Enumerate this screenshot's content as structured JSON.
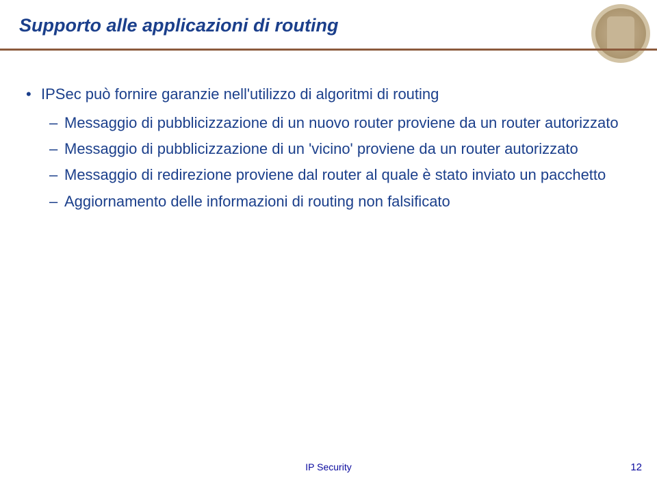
{
  "title": "Supporto alle applicazioni di routing",
  "main_bullet": "IPSec può fornire garanzie nell'utilizzo di algoritmi di routing",
  "sub_bullets": [
    "Messaggio di pubblicizzazione di un nuovo router proviene da un router autorizzato",
    "Messaggio di pubblicizzazione di un 'vicino' proviene da un router autorizzato",
    "Messaggio di redirezione proviene dal router al quale è stato inviato un pacchetto",
    "Aggiornamento delle informazioni di routing non falsificato"
  ],
  "footer": "IP Security",
  "page": "12"
}
